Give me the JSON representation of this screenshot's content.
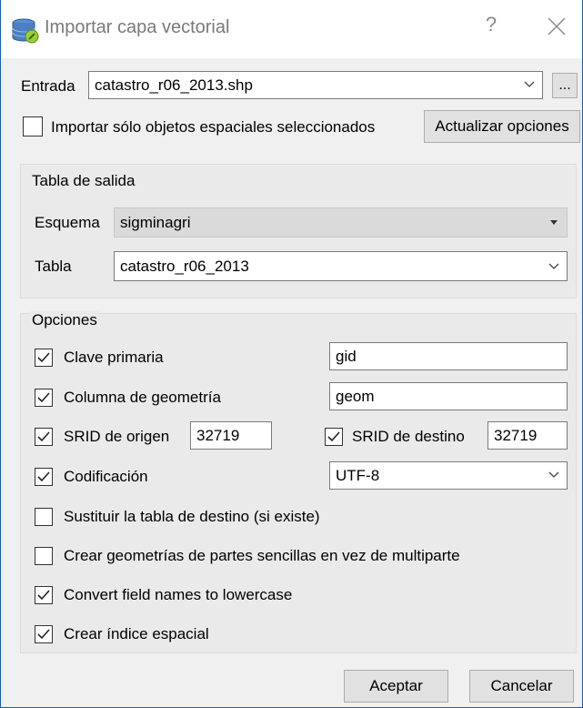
{
  "window": {
    "title": "Importar capa vectorial",
    "help": "?"
  },
  "input": {
    "label": "Entrada",
    "value": "catastro_r06_2013.shp",
    "browse_label": "..."
  },
  "selected_only": {
    "label": "Importar sólo objetos espaciales seleccionados",
    "checked": false
  },
  "update_button": "Actualizar opciones",
  "output_table": {
    "title": "Tabla de salida",
    "schema_label": "Esquema",
    "schema_value": "sigminagri",
    "table_label": "Tabla",
    "table_value": "catastro_r06_2013"
  },
  "options": {
    "title": "Opciones",
    "primary_key": {
      "label": "Clave primaria",
      "checked": true,
      "value": "gid"
    },
    "geometry_column": {
      "label": "Columna de geometría",
      "checked": true,
      "value": "geom"
    },
    "source_srid": {
      "label": "SRID de origen",
      "checked": true,
      "value": "32719"
    },
    "target_srid": {
      "label": "SRID de destino",
      "checked": true,
      "value": "32719"
    },
    "encoding": {
      "label": "Codificación",
      "checked": true,
      "value": "UTF-8"
    },
    "replace_table": {
      "label": "Sustituir la tabla de destino (si existe)",
      "checked": false
    },
    "single_parts": {
      "label": "Crear geometrías de partes sencillas en vez de multiparte",
      "checked": false
    },
    "lowercase": {
      "label": "Convert field names to lowercase",
      "checked": true
    },
    "spatial_index": {
      "label": "Crear índice espacial",
      "checked": true
    }
  },
  "buttons": {
    "accept": "Aceptar",
    "cancel": "Cancelar"
  },
  "colors": {
    "window_border": "#1e5ca8",
    "dialog_bg": "#f0f0f0",
    "group_bg": "#eaeaea"
  }
}
